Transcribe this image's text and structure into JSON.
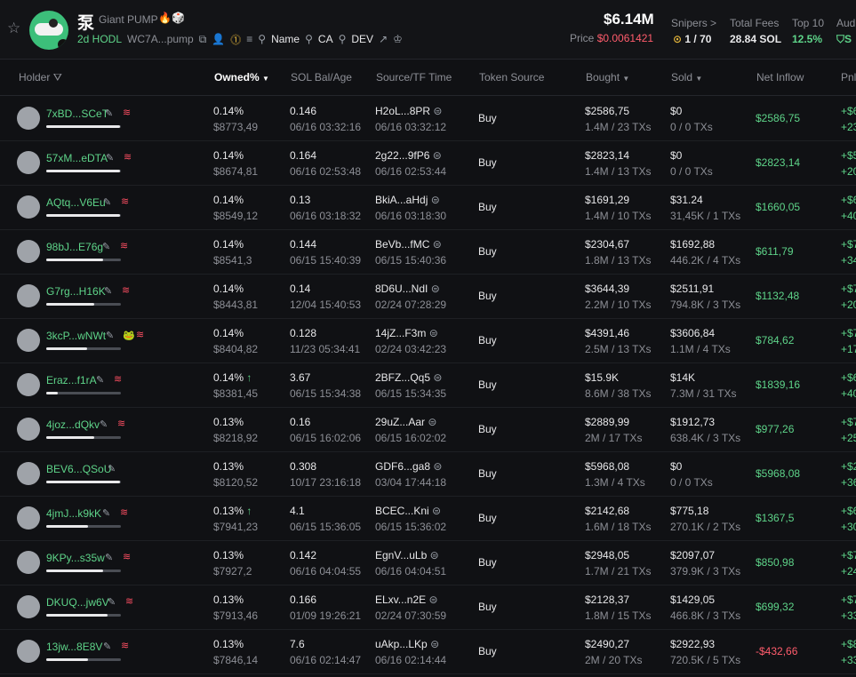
{
  "token": {
    "symbol": "泵",
    "name": "Giant PUMP",
    "icon_flame": "🔥",
    "icon_game": "🎲",
    "age": "2d HODL",
    "address": "WC7A...pump",
    "links": [
      "Name",
      "CA",
      "DEV"
    ],
    "market_cap": "$6.14M",
    "price_label": "Price",
    "price_value": "$0.0061421"
  },
  "stats": [
    {
      "label": "Snipers >",
      "value": "1 / 70"
    },
    {
      "label": "Total Fees",
      "value": "28.84 SOL"
    },
    {
      "label": "Top 10",
      "value": "12.5%"
    },
    {
      "label": "Aud",
      "value": "S"
    }
  ],
  "columns": {
    "holder": "Holder",
    "owned": "Owned%",
    "sol_bal": "SOL Bal/Age",
    "source_tf": "Source/TF Time",
    "token_source": "Token Source",
    "bought": "Bought",
    "sold": "Sold",
    "net_inflow": "Net Inflow",
    "pnl": "Pnl"
  },
  "colors": {
    "green": "#5ed489",
    "red": "#ff5c6c",
    "accent_pink": "#ff4f63"
  },
  "rows": [
    {
      "holder": "7xBD...SCeT",
      "bar": 0.99,
      "owned": "0.14%",
      "owned_usd": "$8773,49",
      "sol": "0.146",
      "sol_time": "06/16 03:32:16",
      "src": "H2oL...8PR",
      "src_time": "06/16 03:32:12",
      "token_source": "Buy",
      "bought": "$2586,75",
      "bought_sub": "1.4M / 23 TXs",
      "sold": "$0",
      "sold_sub": "0 / 0 TXs",
      "net": "$2586,75",
      "net_neg": false,
      "pnl1": "+$6",
      "pnl2": "+23"
    },
    {
      "holder": "57xM...eDTA",
      "bar": 0.99,
      "owned": "0.14%",
      "owned_usd": "$8674,81",
      "sol": "0.164",
      "sol_time": "06/16 02:53:48",
      "src": "2g22...9fP6",
      "src_time": "06/16 02:53:44",
      "token_source": "Buy",
      "bought": "$2823,14",
      "bought_sub": "1.4M / 13 TXs",
      "sold": "$0",
      "sold_sub": "0 / 0 TXs",
      "net": "$2823,14",
      "net_neg": false,
      "pnl1": "+$5",
      "pnl2": "+20"
    },
    {
      "holder": "AQtq...V6Eu",
      "bar": 0.99,
      "owned": "0.14%",
      "owned_usd": "$8549,12",
      "sol": "0.13",
      "sol_time": "06/16 03:18:32",
      "src": "BkiA...aHdj",
      "src_time": "06/16 03:18:30",
      "token_source": "Buy",
      "bought": "$1691,29",
      "bought_sub": "1.4M / 10 TXs",
      "sold": "$31.24",
      "sold_sub": "31,45K / 1 TXs",
      "net": "$1660,05",
      "net_neg": false,
      "pnl1": "+$6",
      "pnl2": "+40"
    },
    {
      "holder": "98bJ...E76g",
      "bar": 0.76,
      "owned": "0.14%",
      "owned_usd": "$8541,3",
      "sol": "0.144",
      "sol_time": "06/15 15:40:39",
      "src": "BeVb...fMC",
      "src_time": "06/15 15:40:36",
      "token_source": "Buy",
      "bought": "$2304,67",
      "bought_sub": "1.8M / 13 TXs",
      "sold": "$1692,88",
      "sold_sub": "446.2K / 4 TXs",
      "net": "$611,79",
      "net_neg": false,
      "pnl1": "+$7",
      "pnl2": "+34"
    },
    {
      "holder": "G7rg...H16K",
      "bar": 0.64,
      "owned": "0.14%",
      "owned_usd": "$8443,81",
      "sol": "0.14",
      "sol_time": "12/04 15:40:53",
      "src": "8D6U...NdI",
      "src_time": "02/24 07:28:29",
      "token_source": "Buy",
      "bought": "$3644,39",
      "bought_sub": "2.2M / 10 TXs",
      "sold": "$2511,91",
      "sold_sub": "794.8K / 3 TXs",
      "net": "$1132,48",
      "net_neg": false,
      "pnl1": "+$7",
      "pnl2": "+20"
    },
    {
      "holder": "3kcP...wNWt",
      "bar": 0.55,
      "owned": "0.14%",
      "owned_usd": "$8404,82",
      "sol": "0.128",
      "sol_time": "11/23 05:34:41",
      "src": "14jZ...F3m",
      "src_time": "02/24 03:42:23",
      "token_source": "Buy",
      "bought": "$4391,46",
      "bought_sub": "2.5M / 13 TXs",
      "sold": "$3606,84",
      "sold_sub": "1.1M / 4 TXs",
      "net": "$784,62",
      "net_neg": false,
      "pnl1": "+$7",
      "pnl2": "+17"
    },
    {
      "holder": "Eraz...f1rA",
      "bar": 0.16,
      "owned": "0.14%",
      "owned_up": true,
      "owned_usd": "$8381,45",
      "sol": "3.67",
      "sol_time": "06/15 15:34:38",
      "src": "2BFZ...Qq5",
      "src_time": "06/15 15:34:35",
      "token_source": "Buy",
      "bought": "$15.9K",
      "bought_sub": "8.6M / 38 TXs",
      "sold": "$14K",
      "sold_sub": "7.3M / 31 TXs",
      "net": "$1839,16",
      "net_neg": false,
      "pnl1": "+$6",
      "pnl2": "+40"
    },
    {
      "holder": "4joz...dQkv",
      "bar": 0.64,
      "owned": "0.13%",
      "owned_usd": "$8218,92",
      "sol": "0.16",
      "sol_time": "06/15 16:02:06",
      "src": "29uZ...Aar",
      "src_time": "06/15 16:02:02",
      "token_source": "Buy",
      "bought": "$2889,99",
      "bought_sub": "2M / 17 TXs",
      "sold": "$1912,73",
      "sold_sub": "638.4K / 3 TXs",
      "net": "$977,26",
      "net_neg": false,
      "pnl1": "+$7",
      "pnl2": "+25"
    },
    {
      "holder": "BEV6...QSoU",
      "bar": 0.99,
      "owned": "0.13%",
      "owned_usd": "$8120,52",
      "sol": "0.308",
      "sol_time": "10/17 23:16:18",
      "src": "GDF6...ga8",
      "src_time": "03/04 17:44:18",
      "token_source": "Buy",
      "bought": "$5968,08",
      "bought_sub": "1.3M / 4 TXs",
      "sold": "$0",
      "sold_sub": "0 / 0 TXs",
      "net": "$5968,08",
      "net_neg": false,
      "pnl1": "+$2",
      "pnl2": "+36"
    },
    {
      "holder": "4jmJ...k9kK",
      "bar": 0.56,
      "owned": "0.13%",
      "owned_up": true,
      "owned_usd": "$7941,23",
      "sol": "4.1",
      "sol_time": "06/15 15:36:05",
      "src": "BCEC...Kni",
      "src_time": "06/15 15:36:02",
      "token_source": "Buy",
      "bought": "$2142,68",
      "bought_sub": "1.6M / 18 TXs",
      "sold": "$775,18",
      "sold_sub": "270.1K / 2 TXs",
      "net": "$1367,5",
      "net_neg": false,
      "pnl1": "+$6",
      "pnl2": "+30"
    },
    {
      "holder": "9KPy...s35w",
      "bar": 0.76,
      "owned": "0.13%",
      "owned_usd": "$7927,2",
      "sol": "0.142",
      "sol_time": "06/16 04:04:55",
      "src": "EgnV...uLb",
      "src_time": "06/16 04:04:51",
      "token_source": "Buy",
      "bought": "$2948,05",
      "bought_sub": "1.7M / 21 TXs",
      "sold": "$2097,07",
      "sold_sub": "379.9K / 3 TXs",
      "net": "$850,98",
      "net_neg": false,
      "pnl1": "+$7",
      "pnl2": "+24"
    },
    {
      "holder": "DKUQ...jw6V",
      "bar": 0.82,
      "owned": "0.13%",
      "owned_usd": "$7913,46",
      "sol": "0.166",
      "sol_time": "01/09 19:26:21",
      "src": "ELxv...n2E",
      "src_time": "02/24 07:30:59",
      "token_source": "Buy",
      "bought": "$2128,37",
      "bought_sub": "1.8M / 15 TXs",
      "sold": "$1429,05",
      "sold_sub": "466.8K / 3 TXs",
      "net": "$699,32",
      "net_neg": false,
      "pnl1": "+$7",
      "pnl2": "+33"
    },
    {
      "holder": "13jw...8E8V",
      "bar": 0.56,
      "owned": "0.13%",
      "owned_usd": "$7846,14",
      "sol": "7.6",
      "sol_time": "06/16 02:14:47",
      "src": "uAkp...LKp",
      "src_time": "06/16 02:14:44",
      "token_source": "Buy",
      "bought": "$2490,27",
      "bought_sub": "2M / 20 TXs",
      "sold": "$2922,93",
      "sold_sub": "720.5K / 5 TXs",
      "net": "-$432,66",
      "net_neg": true,
      "pnl1": "+$8",
      "pnl2": "+33"
    }
  ]
}
